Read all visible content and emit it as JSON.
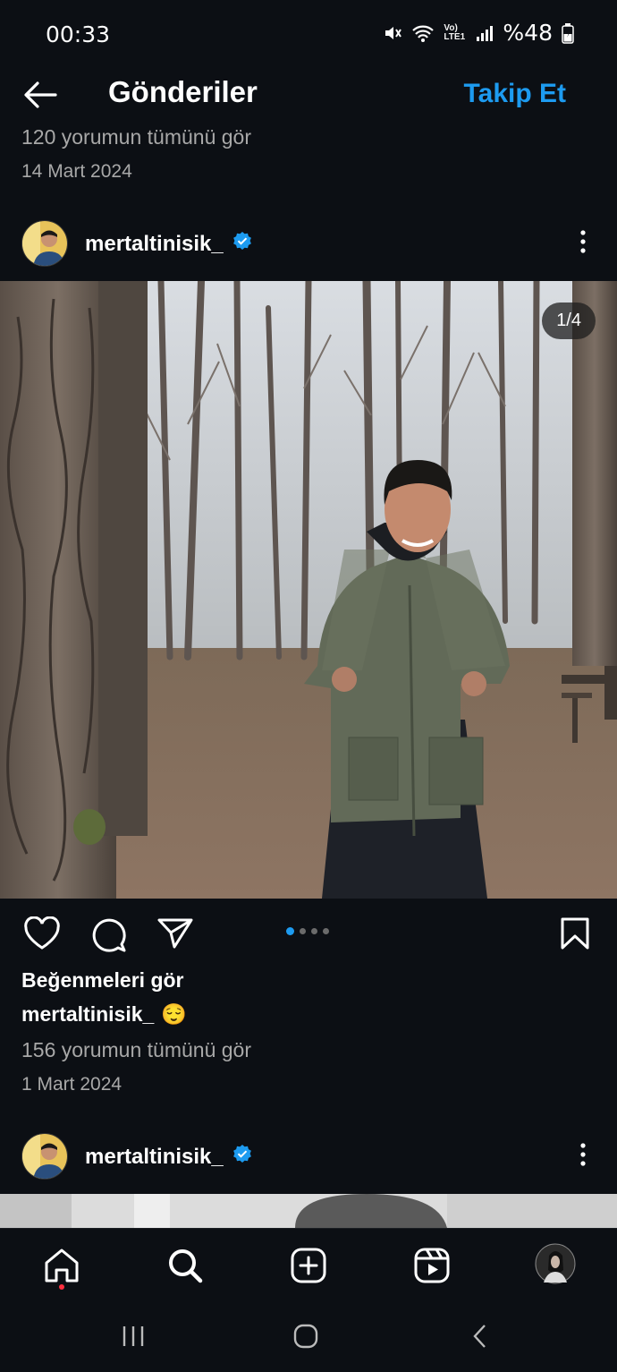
{
  "status_bar": {
    "time": "00:33",
    "network_label": "Vo) LTE1",
    "battery": "%48"
  },
  "header": {
    "title": "Gönderiler",
    "follow_label": "Takip Et"
  },
  "previous_post": {
    "comments_link": "120 yorumun tümünü gör",
    "date": "14 Mart 2024"
  },
  "post": {
    "username": "mertaltinisik_",
    "verified": true,
    "image_counter": "1/4",
    "carousel_total": 4,
    "carousel_active": 1,
    "likes_label": "Beğenmeleri gör",
    "caption_user": "mertaltinisik_",
    "caption_emoji": "😌",
    "comments_link": "156 yorumun tümünü gör",
    "date": "1 Mart 2024"
  },
  "next_post": {
    "username": "mertaltinisik_",
    "verified": true
  },
  "icons": {
    "back": "arrow-left-icon",
    "more": "more-vertical-icon",
    "like": "heart-icon",
    "comment": "comment-icon",
    "share": "send-icon",
    "save": "bookmark-icon",
    "home": "home-icon",
    "search": "search-icon",
    "create": "plus-square-icon",
    "reels": "reels-icon",
    "profile": "profile-avatar"
  },
  "colors": {
    "background": "#0c0f14",
    "accent": "#1d9bf0",
    "secondary_text": "#a8a8a8",
    "notification_dot": "#ff3040"
  }
}
